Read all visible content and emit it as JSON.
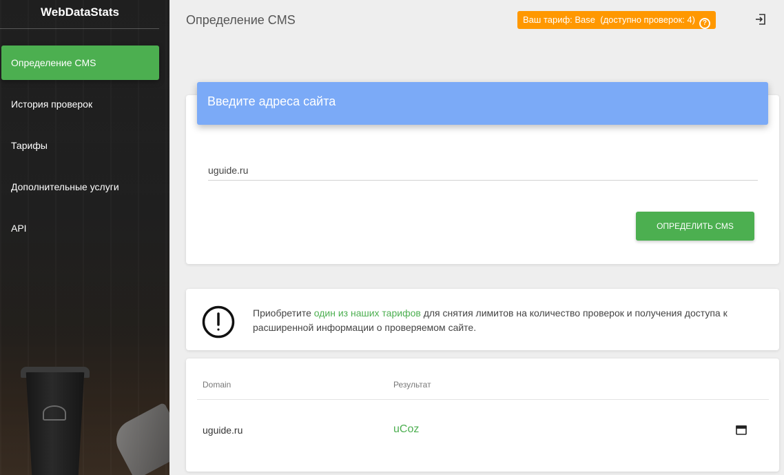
{
  "sidebar": {
    "brand": "WebDataStats",
    "items": [
      {
        "label": "Определение CMS",
        "active": true
      },
      {
        "label": "История проверок"
      },
      {
        "label": "Тарифы"
      },
      {
        "label": "Дополнительные услуги"
      },
      {
        "label": "API"
      }
    ]
  },
  "header": {
    "title": "Определение CMS",
    "tariff_badge": "Ваш тариф: Base  (доступно проверок: 4)",
    "help_icon": "question-circle-icon",
    "logout_icon": "logout-icon"
  },
  "form": {
    "card_title": "Введите адреса сайта",
    "input_value": "uguide.ru",
    "submit_label": "Определить CMS"
  },
  "notice": {
    "icon": "alert-circle-icon",
    "text_before": "Приобретите ",
    "link_text": "один из наших тарифов",
    "text_after": " для снятия лимитов на количество проверок и получения доступа к расширенной информации о проверяемом сайте."
  },
  "results": {
    "columns": [
      "Domain",
      "Результат"
    ],
    "rows": [
      {
        "domain": "uguide.ru",
        "result": "uCoz",
        "action_icon": "open-window-icon"
      }
    ]
  },
  "colors": {
    "accent_green": "#4caf50",
    "badge_orange": "#ff9800",
    "header_blue": "#7baaf7"
  }
}
